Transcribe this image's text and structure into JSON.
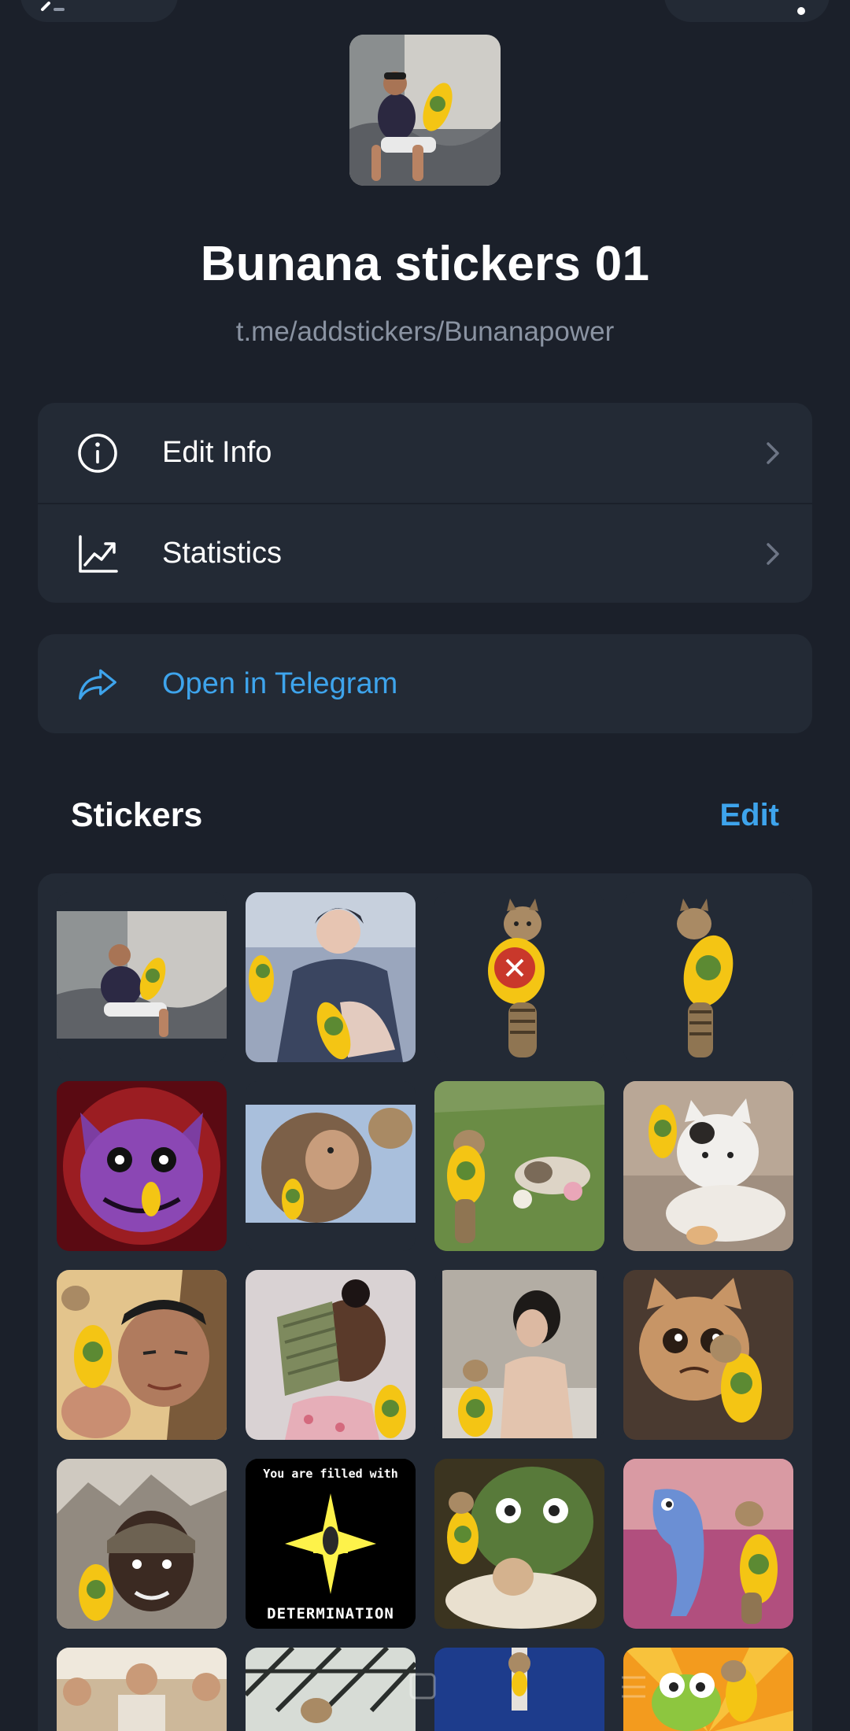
{
  "top_bar": {
    "back_icon": "chevron-left-icon",
    "menu_icon": "more-vertical-icon"
  },
  "pack": {
    "title": "Bunana stickers 01",
    "link": "t.me/addstickers/Bunanapower"
  },
  "menu": {
    "items": [
      {
        "label": "Edit Info",
        "icon": "info-circle-icon"
      },
      {
        "label": "Statistics",
        "icon": "chart-trend-icon"
      }
    ],
    "open_label": "Open in Telegram",
    "open_icon": "share-arrow-icon"
  },
  "stickers_section": {
    "title": "Stickers",
    "edit_label": "Edit",
    "items": [
      {
        "name": "man-sofa-banana-sticker"
      },
      {
        "name": "anime-man-banana-sticker"
      },
      {
        "name": "cat-banana-fire-sticker"
      },
      {
        "name": "cat-banana-sticker"
      },
      {
        "name": "purple-cat-monster-sticker"
      },
      {
        "name": "monkey-cat-sticker"
      },
      {
        "name": "cat-lawn-sticker"
      },
      {
        "name": "white-cat-sticker"
      },
      {
        "name": "man-selfie-sticker"
      },
      {
        "name": "girl-money-sticker"
      },
      {
        "name": "woman-bath-sticker"
      },
      {
        "name": "crying-cat-sticker"
      },
      {
        "name": "soldier-sticker"
      },
      {
        "name": "determination-sticker",
        "text_top": "You are filled with",
        "text_bottom": "DETERMINATION"
      },
      {
        "name": "owl-sleeping-sticker"
      },
      {
        "name": "dolphin-sticker"
      },
      {
        "name": "group-photo-sticker"
      },
      {
        "name": "greenhouse-sticker"
      },
      {
        "name": "blue-cat-sticker"
      },
      {
        "name": "frog-cartoon-sticker"
      }
    ]
  },
  "colors": {
    "background": "#1b202a",
    "card": "#232a35",
    "accent": "#3ea4ec",
    "secondary_text": "#8a93a2"
  }
}
